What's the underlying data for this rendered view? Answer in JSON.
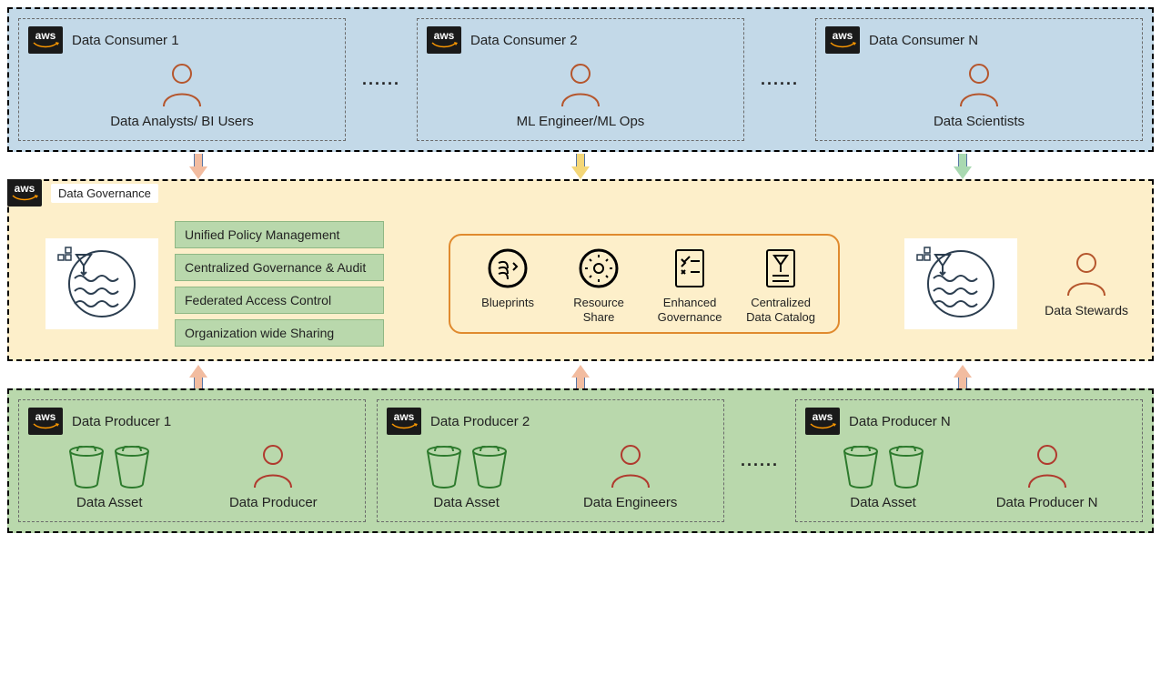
{
  "consumers": {
    "items": [
      {
        "title": "Data Consumer 1",
        "role": "Data Analysts/ BI Users"
      },
      {
        "title": "Data Consumer 2",
        "role": "ML Engineer/ML Ops"
      },
      {
        "title": "Data Consumer N",
        "role": "Data Scientists"
      }
    ]
  },
  "governance": {
    "title": "Data Governance",
    "pills": [
      "Unified Policy Management",
      "Centralized  Governance & Audit",
      "Federated Access Control",
      "Organization wide Sharing"
    ],
    "capsule": [
      "Blueprints",
      "Resource Share",
      "Enhanced Governance",
      "Centralized Data Catalog"
    ],
    "steward_label": "Data Stewards"
  },
  "producers": {
    "items": [
      {
        "title": "Data Producer 1",
        "asset": "Data Asset",
        "role": "Data Producer"
      },
      {
        "title": "Data Producer 2",
        "asset": "Data Asset",
        "role": "Data Engineers"
      },
      {
        "title": "Data Producer N",
        "asset": "Data Asset",
        "role": "Data Producer N"
      }
    ]
  },
  "ellipsis": "......",
  "aws_label": "aws"
}
